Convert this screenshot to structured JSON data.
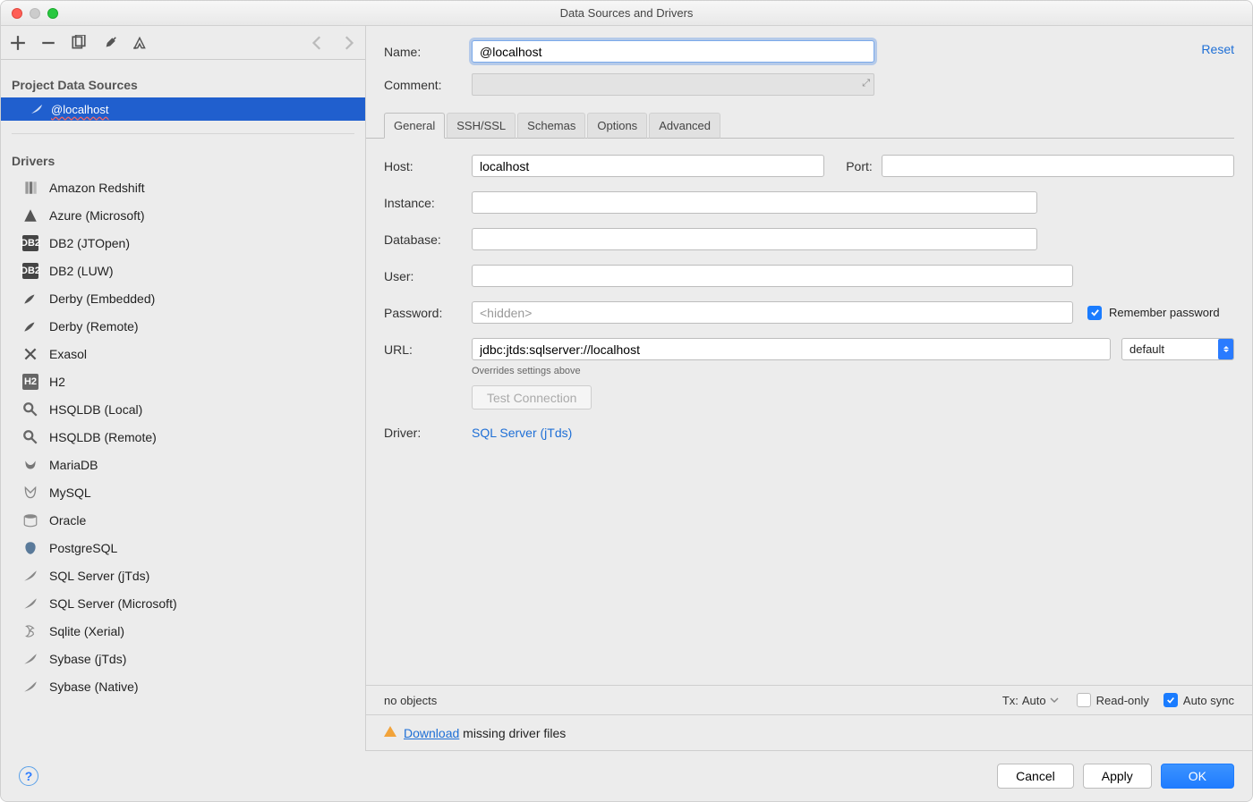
{
  "window": {
    "title": "Data Sources and Drivers"
  },
  "sidebar": {
    "sections_ds": "Project Data Sources",
    "sections_drv": "Drivers",
    "data_sources": [
      {
        "label": "@localhost",
        "selected": true
      }
    ],
    "drivers": [
      {
        "label": "Amazon Redshift"
      },
      {
        "label": "Azure (Microsoft)"
      },
      {
        "label": "DB2 (JTOpen)"
      },
      {
        "label": "DB2 (LUW)"
      },
      {
        "label": "Derby (Embedded)"
      },
      {
        "label": "Derby (Remote)"
      },
      {
        "label": "Exasol"
      },
      {
        "label": "H2"
      },
      {
        "label": "HSQLDB (Local)"
      },
      {
        "label": "HSQLDB (Remote)"
      },
      {
        "label": "MariaDB"
      },
      {
        "label": "MySQL"
      },
      {
        "label": "Oracle"
      },
      {
        "label": "PostgreSQL"
      },
      {
        "label": "SQL Server (jTds)"
      },
      {
        "label": "SQL Server (Microsoft)"
      },
      {
        "label": "Sqlite (Xerial)"
      },
      {
        "label": "Sybase (jTds)"
      },
      {
        "label": "Sybase (Native)"
      }
    ]
  },
  "form": {
    "name_label": "Name:",
    "name_value": "@localhost",
    "comment_label": "Comment:",
    "reset": "Reset",
    "tabs": [
      "General",
      "SSH/SSL",
      "Schemas",
      "Options",
      "Advanced"
    ],
    "host_label": "Host:",
    "host_value": "localhost",
    "port_label": "Port:",
    "port_value": "",
    "instance_label": "Instance:",
    "instance_value": "",
    "database_label": "Database:",
    "database_value": "",
    "user_label": "User:",
    "user_value": "",
    "password_label": "Password:",
    "password_placeholder": "<hidden>",
    "remember_label": "Remember password",
    "remember_checked": true,
    "url_label": "URL:",
    "url_value": "jdbc:jtds:sqlserver://localhost",
    "url_mode_label": "default",
    "override_hint": "Overrides settings above",
    "test_connection": "Test Connection",
    "driver_label": "Driver:",
    "driver_link": "SQL Server (jTds)",
    "no_objects": "no objects",
    "tx_label": "Tx:",
    "tx_value": "Auto",
    "readonly_label": "Read-only",
    "readonly_checked": false,
    "autosync_label": "Auto sync",
    "autosync_checked": true,
    "download_link": "Download",
    "download_suffix": " missing driver files"
  },
  "footer": {
    "cancel": "Cancel",
    "apply": "Apply",
    "ok": "OK"
  }
}
